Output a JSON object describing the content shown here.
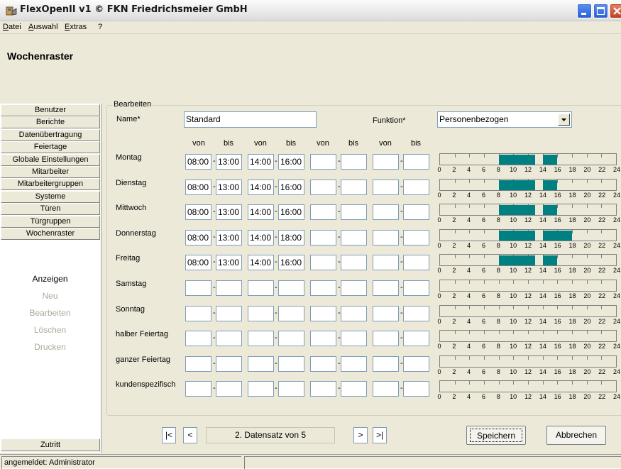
{
  "window": {
    "title": "FlexOpenII v1 © FKN Friedrichsmeier GmbH"
  },
  "menu": [
    "Datei",
    "Auswahl",
    "Extras",
    "?"
  ],
  "page_title": "Wochenraster",
  "sidebar": {
    "buttons": [
      "Benutzer",
      "Berichte",
      "Datenübertragung",
      "Feiertage",
      "Globale Einstellungen",
      "Mitarbeiter",
      "Mitarbeitergruppen",
      "Systeme",
      "Türen",
      "Türgruppen",
      "Wochenraster"
    ],
    "actions": [
      {
        "label": "Anzeigen",
        "enabled": true
      },
      {
        "label": "Neu",
        "enabled": false
      },
      {
        "label": "Bearbeiten",
        "enabled": false
      },
      {
        "label": "Löschen",
        "enabled": false
      },
      {
        "label": "Drucken",
        "enabled": false
      }
    ],
    "bottom_button": "Zutritt"
  },
  "form": {
    "group_title": "Bearbeiten",
    "name_label": "Name*",
    "name_value": "Standard",
    "funktion_label": "Funktion*",
    "funktion_value": "Personenbezogen",
    "col_headers": [
      "von",
      "bis",
      "von",
      "bis",
      "von",
      "bis",
      "von",
      "bis"
    ],
    "days": [
      {
        "label": "Montag",
        "times": [
          "08:00",
          "13:00",
          "14:00",
          "16:00",
          "",
          "",
          "",
          ""
        ]
      },
      {
        "label": "Dienstag",
        "times": [
          "08:00",
          "13:00",
          "14:00",
          "16:00",
          "",
          "",
          "",
          ""
        ]
      },
      {
        "label": "Mittwoch",
        "times": [
          "08:00",
          "13:00",
          "14:00",
          "16:00",
          "",
          "",
          "",
          ""
        ]
      },
      {
        "label": "Donnerstag",
        "times": [
          "08:00",
          "13:00",
          "14:00",
          "18:00",
          "",
          "",
          "",
          ""
        ]
      },
      {
        "label": "Freitag",
        "times": [
          "08:00",
          "13:00",
          "14:00",
          "16:00",
          "",
          "",
          "",
          ""
        ]
      },
      {
        "label": "Samstag",
        "times": [
          "",
          "",
          "",
          "",
          "",
          "",
          "",
          ""
        ]
      },
      {
        "label": "Sonntag",
        "times": [
          "",
          "",
          "",
          "",
          "",
          "",
          "",
          ""
        ]
      },
      {
        "label": "halber Feiertag",
        "times": [
          "",
          "",
          "",
          "",
          "",
          "",
          "",
          ""
        ]
      },
      {
        "label": "ganzer Feiertag",
        "times": [
          "",
          "",
          "",
          "",
          "",
          "",
          "",
          ""
        ]
      },
      {
        "label": "kundenspezifisch",
        "times": [
          "",
          "",
          "",
          "",
          "",
          "",
          "",
          ""
        ]
      }
    ],
    "timeline_ticks": [
      "0",
      "2",
      "4",
      "6",
      "8",
      "10",
      "12",
      "14",
      "16",
      "18",
      "20",
      "22",
      "24"
    ],
    "timeline_color": "#008080"
  },
  "navigator": {
    "first": "|<",
    "prev": "<",
    "record": "2. Datensatz von 5",
    "next": ">",
    "last": ">|"
  },
  "buttons": {
    "save": "Speichern",
    "cancel": "Abbrechen"
  },
  "status": {
    "user": "angemeldet: Administrator",
    "extra": ""
  }
}
